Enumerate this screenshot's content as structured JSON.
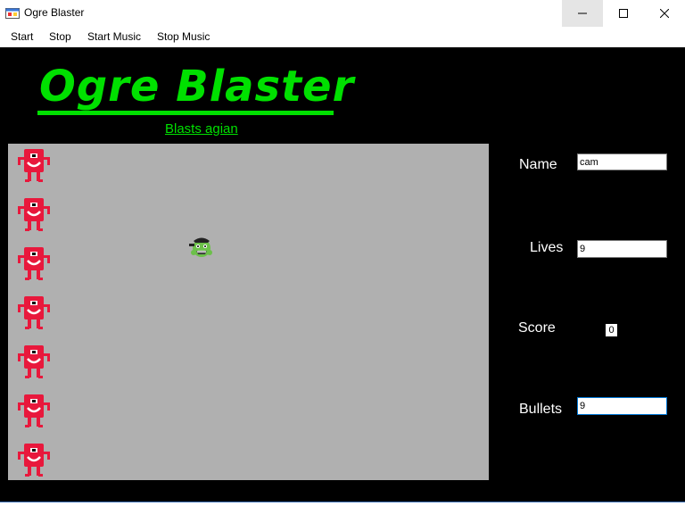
{
  "window": {
    "title": "Ogre Blaster",
    "icon": "app-window-icon"
  },
  "menu": {
    "items": [
      "Start",
      "Stop",
      "Start Music",
      "Stop Music"
    ]
  },
  "header": {
    "title": "Ogre Blaster",
    "subtitle": "Blasts agian"
  },
  "colors": {
    "background": "#000000",
    "accent": "#00e000",
    "game_area": "#b0b0b0",
    "ogre": "#e8183c"
  },
  "game": {
    "ogre_count": 7,
    "enemy_icon": "red-ogre-icon",
    "player_icon": "green-ogre-player-icon"
  },
  "fields": {
    "name": {
      "label": "Name",
      "value": "cam"
    },
    "lives": {
      "label": "Lives",
      "value": "9"
    },
    "score": {
      "label": "Score",
      "value": "0"
    },
    "bullets": {
      "label": "Bullets",
      "value": "9"
    }
  }
}
